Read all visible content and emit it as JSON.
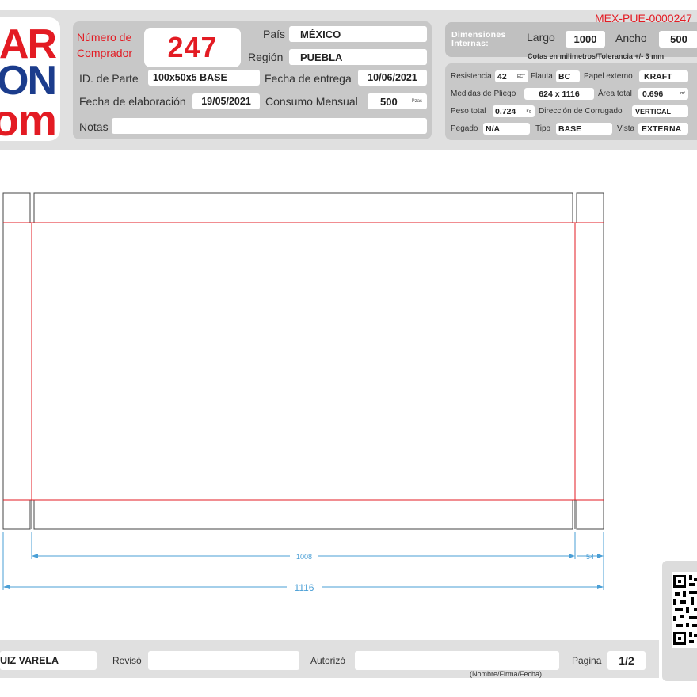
{
  "doc_code": "MEX-PUE-0000247",
  "logo": {
    "line1": "AR",
    "line2": "ON",
    "line3": "om"
  },
  "header": {
    "buyer_label": "Número de Comprador",
    "buyer_number": "247",
    "country_label": "País",
    "country": "MÉXICO",
    "region_label": "Región",
    "region": "PUEBLA",
    "part_id_label": "ID. de Parte",
    "part_id": "100x50x5 BASE",
    "delivery_label": "Fecha de entrega",
    "delivery_date": "10/06/2021",
    "made_label": "Fecha de elaboración",
    "made_date": "19/05/2021",
    "consumption_label": "Consumo Mensual",
    "consumption": "500",
    "consumption_unit": "Pzas",
    "notes_label": "Notas",
    "notes": ""
  },
  "dimensions": {
    "title": "Dimensiones Internas:",
    "length_label": "Largo",
    "length": "1000",
    "width_label": "Ancho",
    "width": "500",
    "note": "Cotas en milimetros/Tolerancia +/- 3 mm"
  },
  "specs": {
    "resistance_label": "Resistencia",
    "resistance": "42",
    "resistance_unit": "ECT",
    "flute_label": "Flauta",
    "flute": "BC",
    "outer_paper_label": "Papel externo",
    "outer_paper": "KRAFT",
    "sheet_label": "Medidas de Pliego",
    "sheet": "624 x 1116",
    "area_label": "Área total",
    "area": "0.696",
    "area_unit": "m²",
    "weight_label": "Peso total",
    "weight": "0.724",
    "weight_unit": "Kg.",
    "corrugation_label": "Dirección de Corrugado",
    "corrugation": "VERTICAL",
    "glued_label": "Pegado",
    "glued": "N/A",
    "type_label": "Tipo",
    "type": "BASE",
    "view_label": "Vista",
    "view": "EXTERNA"
  },
  "drawing": {
    "dim_inner": "1008",
    "dim_flap": "54",
    "dim_total": "1116",
    "line_color": "#e31b23",
    "cut_color": "#444444",
    "dim_color": "#4a9fd6"
  },
  "footer": {
    "author": "UIZ VARELA",
    "reviewed_label": "Revisó",
    "reviewed": "",
    "authorized_label": "Autorizó",
    "authorized": "",
    "sign_note": "(Nombre/Firma/Fecha)",
    "page_label": "Pagina",
    "page": "1/2"
  }
}
